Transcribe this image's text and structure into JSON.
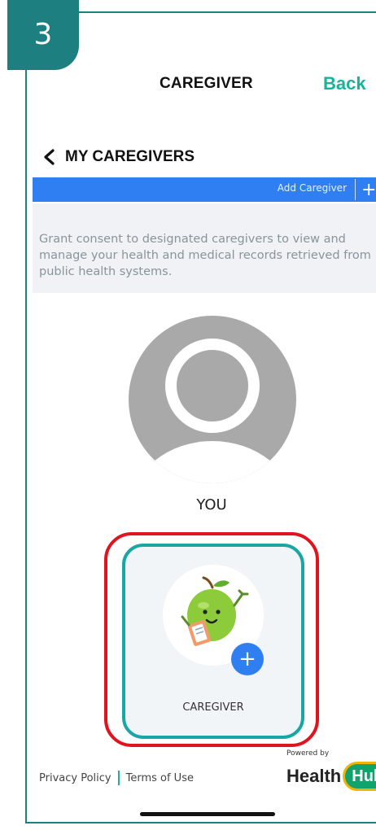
{
  "step_badge": "3",
  "header": {
    "title": "CAREGIVER",
    "back_label": "Back"
  },
  "section": {
    "title": "MY CAREGIVERS"
  },
  "toolbar": {
    "add_caregiver_label": "Add Caregiver",
    "add_icon": "+"
  },
  "consent_text": "Grant consent to designated caregivers to view and manage your health and medical records retrieved from public health systems.",
  "self": {
    "label": "YOU"
  },
  "caregiver_card": {
    "label": "CAREGIVER",
    "add_icon": "+"
  },
  "footer": {
    "privacy_label": "Privacy Policy",
    "terms_label": "Terms of Use",
    "powered_by": "Powered by",
    "logo_text": "Health",
    "logo_badge": "Hub"
  },
  "colors": {
    "teal": "#1d7f80",
    "accent": "#19b29a",
    "blue": "#2f7ff2",
    "highlight_red": "#e0141e",
    "highlight_teal": "#1aa6a4"
  }
}
